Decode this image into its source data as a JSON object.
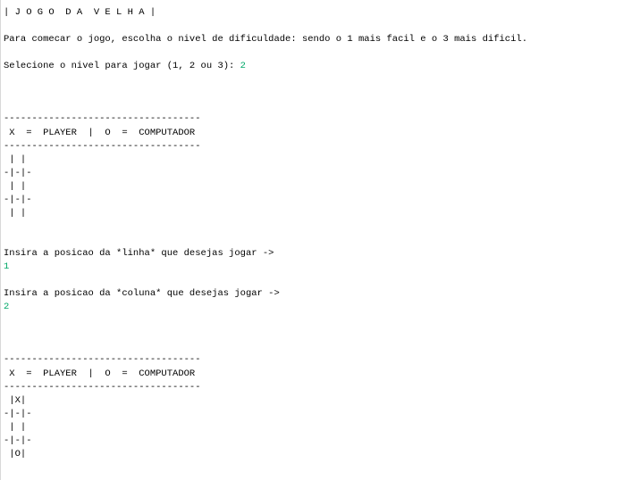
{
  "colors": {
    "background": "#ffffff",
    "output_text": "#000000",
    "user_input": "#00a868"
  },
  "console": {
    "title": "| J O G O  D A  V E L H A |",
    "intro": "Para comecar o jogo, escolha o nivel de dificuldade: sendo o 1 mais facil e o 3 mais dificil.",
    "level_prompt": "Selecione o nivel para jogar (1, 2 ou 3): ",
    "level_input": "2",
    "board1": {
      "separator_top": "-----------------------------------",
      "legend": " X  =  PLAYER  |  O  =  COMPUTADOR",
      "separator_bottom": "-----------------------------------",
      "rows": [
        " | |",
        "-|-|-",
        " | |",
        "-|-|-",
        " | |"
      ]
    },
    "row_prompt": "Insira a posicao da *linha* que desejas jogar ->",
    "row_input": "1",
    "col_prompt": "Insira a posicao da *coluna* que desejas jogar ->",
    "col_input": "2",
    "board2": {
      "separator_top": "-----------------------------------",
      "legend": " X  =  PLAYER  |  O  =  COMPUTADOR",
      "separator_bottom": "-----------------------------------",
      "rows": [
        " |X|",
        "-|-|-",
        " | |",
        "-|-|-",
        " |O|"
      ]
    }
  }
}
